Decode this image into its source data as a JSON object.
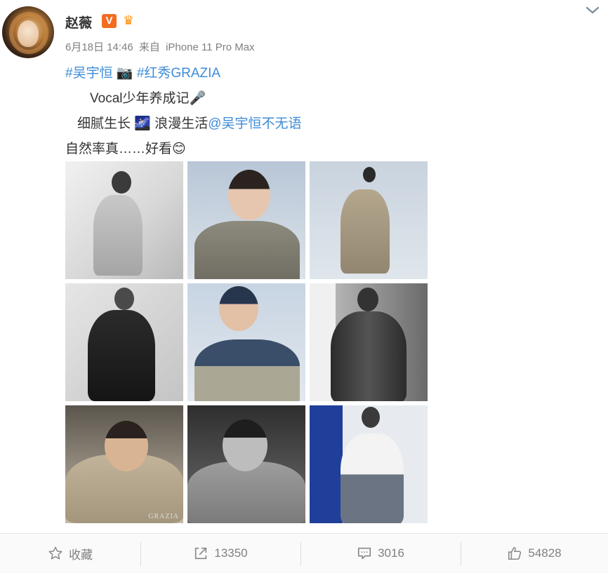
{
  "post": {
    "username": "赵薇",
    "verified_badge": "V",
    "crown_icon": "crown-icon",
    "date": "6月18日 14:46",
    "source_prefix": "来自",
    "source_device": "iPhone 11 Pro Max",
    "content": {
      "line1_tag1": "#吴宇恒",
      "line1_camera_emoji": "📷",
      "line1_tag2": "#红秀GRAZIA",
      "line2_text": "Vocal少年养成记",
      "line2_mic_emoji": "🎤",
      "line3_text_a": "细腻生长",
      "line3_emoji": "🌌",
      "line3_text_b": "浪漫生活",
      "line3_mention": "@吴宇恒不无语",
      "line4_text": "自然率真……好看",
      "line4_emoji": "😊"
    },
    "photos": [
      {
        "name": "photo-1",
        "watermark": ""
      },
      {
        "name": "photo-2",
        "watermark": ""
      },
      {
        "name": "photo-3",
        "watermark": ""
      },
      {
        "name": "photo-4",
        "watermark": ""
      },
      {
        "name": "photo-5",
        "watermark": ""
      },
      {
        "name": "photo-6",
        "watermark": ""
      },
      {
        "name": "photo-7",
        "watermark": "GRAZIA"
      },
      {
        "name": "photo-8",
        "watermark": ""
      },
      {
        "name": "photo-9",
        "watermark": ""
      }
    ]
  },
  "footer": {
    "favorite_label": "收藏",
    "repost_count": "13350",
    "comment_count": "3016",
    "like_count": "54828"
  },
  "colors": {
    "link": "#3d8bd8",
    "text": "#333333",
    "meta": "#808080",
    "verified_orange": "#f36d22"
  }
}
